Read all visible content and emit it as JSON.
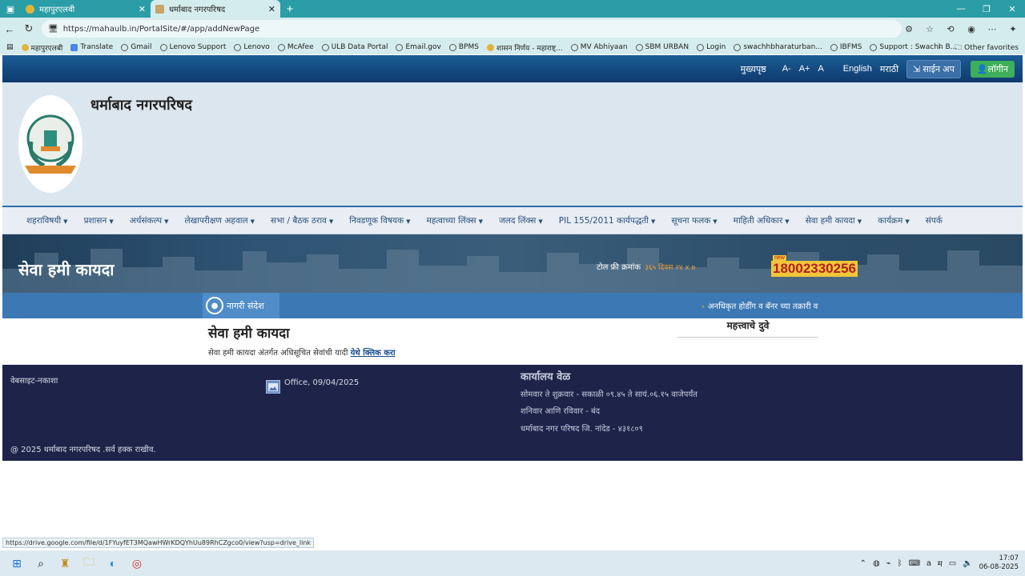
{
  "browser": {
    "tabs": [
      {
        "title": "महापुरएलबी",
        "active": false
      },
      {
        "title": "धर्माबाद नगरपरिषद",
        "active": true
      }
    ],
    "url": "https://mahaulb.in/PortalSite/#/app/addNewPage",
    "bookmarks": [
      "महापुरएलबी",
      "Translate",
      "Gmail",
      "Lenovo Support",
      "Lenovo",
      "McAfee",
      "ULB Data Portal",
      "Email.gov",
      "BPMS",
      "शासन निर्णय - महाराष्ट्...",
      "MV Abhiyaan",
      "SBM URBAN",
      "Login",
      "swachhbharaturban...",
      "IBFMS",
      "Support : Swachh B..."
    ],
    "other_favorites": "Other favorites",
    "status_url": "https://drive.google.com/file/d/1FYuyfET3MQawHWrKDQYhUu89RhCZgco0/view?usp=drive_link"
  },
  "topstrip": {
    "home": "मुख्यपृष्ठ",
    "font_small": "A-",
    "font_large": "A+",
    "font_normal": "A",
    "lang_en": "English",
    "lang_mr": "मराठी",
    "signup": "साईन अप",
    "login": "लॉगीन"
  },
  "header": {
    "site_title": "धर्माबाद नगरपरिषद",
    "logo_text": "धर्माबाद"
  },
  "menu": [
    "शहराविषयी",
    "प्रशासन",
    "अर्थसंकल्प",
    "लेखापरीक्षण अहवाल",
    "सभा / बैठक ठराव",
    "निवडणूक विषयक",
    "महत्वाच्या लिंक्स",
    "जलद लिंक्स",
    "PIL 155/2011 कार्यपद्धती",
    "सूचना फलक",
    "माहिती अधिकार",
    "सेवा हमी कायदा",
    "कार्यक्रम",
    "संपर्क"
  ],
  "banner": {
    "title": "सेवा हमी कायदा",
    "tollfree_label": "टोल फ्री क्रमांक",
    "tollfree_sub": "३६५ दिवस २४ x ७",
    "new_badge": "new",
    "phone": "18002330256"
  },
  "notice": {
    "label": "नागरी संदेश",
    "ticker": "अनधिकृत होर्डींग व बॅनर च्या तक्रारी व"
  },
  "content": {
    "heading": "सेवा हमी कायदा",
    "desc": "सेवा हमी कायदा अंतर्गत अधिसूचित सेवांची यादी",
    "link": "येथे क्लिक करा",
    "important_links": "महत्त्वाचे दुवे"
  },
  "footer": {
    "sitemap": "वेबसाइट-नकाशा",
    "office_caption": "Office, 09/04/2025",
    "hours_heading": "कार्यालय वेळ",
    "hours_line1": "सोमवार ते शुक्रवार - सकाळी ०९.४५ ते सायं.०६.१५ वाजेपर्यंत",
    "hours_line2": "शनिवार आणि रविवार - बंद",
    "address": "धर्माबाद नगर परिषद जि. नांदेड - ४३१८०९",
    "copyright": "@ 2025 धर्माबाद नगरपरिषद .सर्व हक्क राखीव."
  },
  "taskbar": {
    "time": "17:07",
    "date": "06-08-2025",
    "lang": "म"
  },
  "colors": {
    "tabbar": "#2a9da6",
    "topstrip": "#1b5d95",
    "footer": "#1d2349",
    "phone_bg": "#f2c63a",
    "phone_text": "#b02020"
  }
}
